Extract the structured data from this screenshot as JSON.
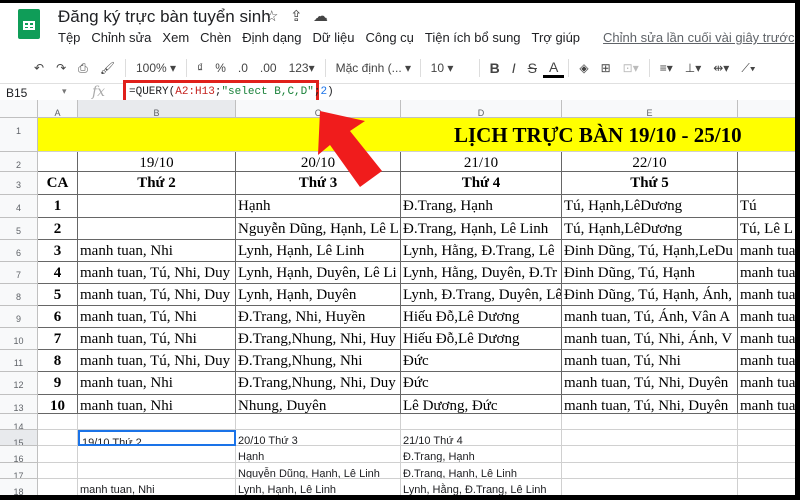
{
  "app": {
    "title": "Đăng ký trực bàn tuyển sinh",
    "star_icon": "star-icon",
    "move_icon": "move-to-drive-icon",
    "cloud_icon": "cloud-status-icon"
  },
  "menu": [
    "Tệp",
    "Chỉnh sửa",
    "Xem",
    "Chèn",
    "Định dạng",
    "Dữ liệu",
    "Công cụ",
    "Tiện ích bổ sung",
    "Trợ giúp"
  ],
  "last_edit": "Chỉnh sửa lần cuối vài giây trước",
  "toolbar": {
    "undo": "↶",
    "redo": "↷",
    "print": "⎙",
    "paint": "🖌",
    "zoom": "100%",
    "currency": "₫",
    "percent": "%",
    "dec_less": ".0",
    "dec_more": ".00",
    "format": "123",
    "font": "Mặc định (...",
    "size": "10",
    "bold": "B",
    "italic": "I",
    "strike": "S",
    "textcolor": "A"
  },
  "formula_bar": {
    "cell": "B15",
    "fx": "fx",
    "formula_parts": [
      "=QUERY(",
      "A2:H13",
      ";",
      "\"select B,C,D\"",
      ";",
      "2",
      ")"
    ]
  },
  "columns": [
    "A",
    "B",
    "C",
    "D",
    "E"
  ],
  "rows": [
    "1",
    "2",
    "3",
    "4",
    "5",
    "6",
    "7",
    "8",
    "9",
    "10",
    "11",
    "12",
    "13",
    "14",
    "15",
    "16",
    "17",
    "18"
  ],
  "sheet": {
    "title": "LỊCH TRỰC BÀN 19/10 - 25/10",
    "dates": [
      "19/10",
      "20/10",
      "21/10",
      "22/10"
    ],
    "ca_label": "CA",
    "days": [
      "Thứ 2",
      "Thứ 3",
      "Thứ 4",
      "Thứ 5"
    ],
    "shifts": [
      [
        "1",
        "",
        "Hạnh",
        "Đ.Trang, Hạnh",
        "Tú, Hạnh,LêDương",
        "Tú"
      ],
      [
        "2",
        "",
        "Nguyễn Dũng, Hạnh, Lê L",
        "Đ.Trang, Hạnh, Lê Linh",
        "Tú, Hạnh,LêDương",
        "Tú, Lê L"
      ],
      [
        "3",
        "manh tuan, Nhi",
        "Lynh, Hạnh, Lê Linh",
        "Lynh, Hằng, Đ.Trang, Lê",
        "Đinh Dũng, Tú, Hạnh,LeDu",
        "manh tua"
      ],
      [
        "4",
        "manh tuan, Tú, Nhi, Duy",
        "Lynh, Hạnh, Duyên, Lê Li",
        "Lynh, Hằng, Duyên, Đ.Tr",
        "Đinh Dũng, Tú, Hạnh",
        "manh tua"
      ],
      [
        "5",
        "manh tuan, Tú, Nhi, Duy",
        "Lynh, Hạnh, Duyên",
        "Lynh, Đ.Trang, Duyên, Lê",
        "Đinh Dũng, Tú, Hạnh, Ánh,",
        "manh tua"
      ],
      [
        "6",
        "manh tuan, Tú, Nhi",
        "Đ.Trang, Nhi, Huyền",
        " Hiếu Đỗ,Lê Dương",
        "manh tuan, Tú, Ánh, Vân A",
        "manh tua"
      ],
      [
        "7",
        "manh tuan, Tú, Nhi",
        "Đ.Trang,Nhung, Nhi, Huy",
        "Hiếu Đỗ,Lê Dương",
        "manh tuan, Tú, Nhi, Ánh, V",
        "manh tua"
      ],
      [
        "8",
        "manh tuan, Tú, Nhi, Duy",
        "Đ.Trang,Nhung, Nhi",
        "Đức",
        "manh tuan, Tú, Nhi",
        "manh tua"
      ],
      [
        "9",
        "manh tuan, Nhi",
        "Đ.Trang,Nhung, Nhi, Duy",
        "Đức",
        "manh tuan, Tú, Nhi, Duyên",
        "manh tua"
      ],
      [
        "10",
        "manh tuan, Nhi",
        "Nhung, Duyên",
        "Lê Dương, Đức",
        "manh tuan, Tú, Nhi, Duyên",
        "manh tua"
      ]
    ],
    "query_result": [
      [
        "19/10 Thứ 2",
        "20/10 Thứ 3",
        "21/10 Thứ 4"
      ],
      [
        "",
        "Hạnh",
        "Đ.Trang, Hạnh"
      ],
      [
        "",
        "Nguyễn Dũng, Hạnh, Lê Linh",
        "Đ.Trang, Hạnh, Lê Linh"
      ],
      [
        "manh tuan, Nhi",
        "Lynh, Hạnh, Lê Linh",
        "Lynh, Hằng, Đ.Trang, Lê Linh"
      ]
    ]
  },
  "colors": {
    "title_bg": "#ffff00",
    "highlight": "#e0201b",
    "selection": "#1a73e8"
  }
}
